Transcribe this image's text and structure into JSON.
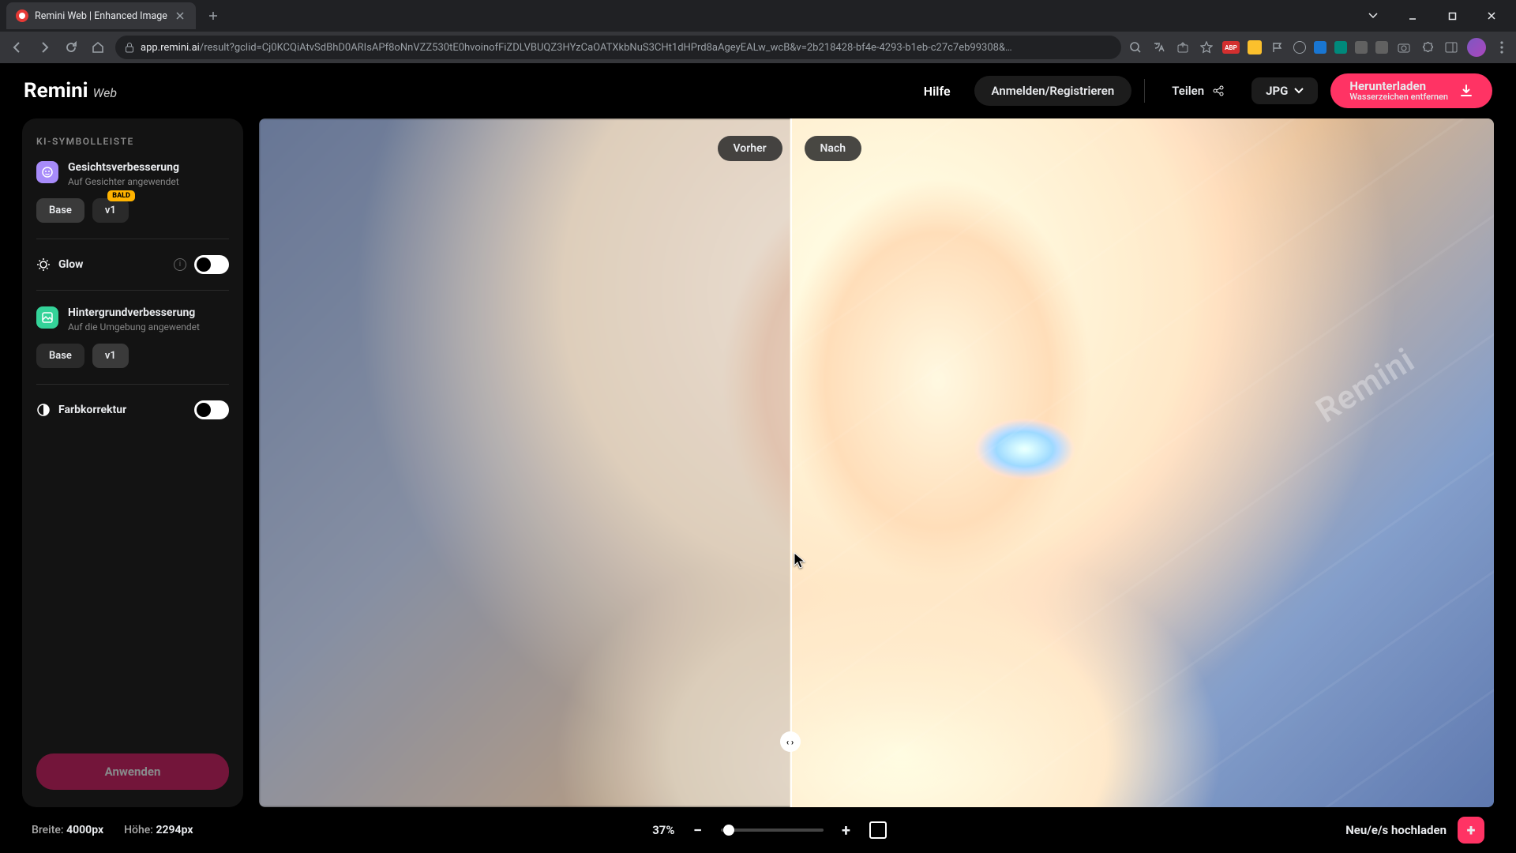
{
  "browser": {
    "tab_title": "Remini Web | Enhanced Image",
    "url_host": "app.remini.ai",
    "url_path": "/result?gclid=Cj0KCQiAtvSdBhD0ARIsAPf8oNnVZZ530tE0hvoinofFiZDLVBUQZ3HYzCaOATXkbNuS3CHt1dHPrd8aAgeyEALw_wcB&v=2b218428-bf4e-4293-b1eb-c27c7eb99308&…",
    "ext_abp": "ABP"
  },
  "header": {
    "logo_main": "Remini",
    "logo_sub": "Web",
    "help": "Hilfe",
    "login": "Anmelden/Registrieren",
    "share": "Teilen",
    "format": "JPG",
    "download_main": "Herunterladen",
    "download_sub": "Wasserzeichen entfernen"
  },
  "sidebar": {
    "title": "KI-SYMBOLLEISTE",
    "face": {
      "title": "Gesichtsverbesserung",
      "sub": "Auf Gesichter angewendet",
      "chip_base": "Base",
      "chip_v1": "v1",
      "badge": "BALD"
    },
    "glow": {
      "label": "Glow"
    },
    "bg": {
      "title": "Hintergrundverbesserung",
      "sub": "Auf die Umgebung angewendet",
      "chip_base": "Base",
      "chip_v1": "v1"
    },
    "color": {
      "label": "Farbkorrektur"
    },
    "apply": "Anwenden"
  },
  "canvas": {
    "before": "Vorher",
    "after": "Nach",
    "watermark": "Remini"
  },
  "footer": {
    "width_label": "Breite:",
    "width_value": "4000px",
    "height_label": "Höhe:",
    "height_value": "2294px",
    "zoom": "37%",
    "upload": "Neu/e/s hochladen"
  }
}
